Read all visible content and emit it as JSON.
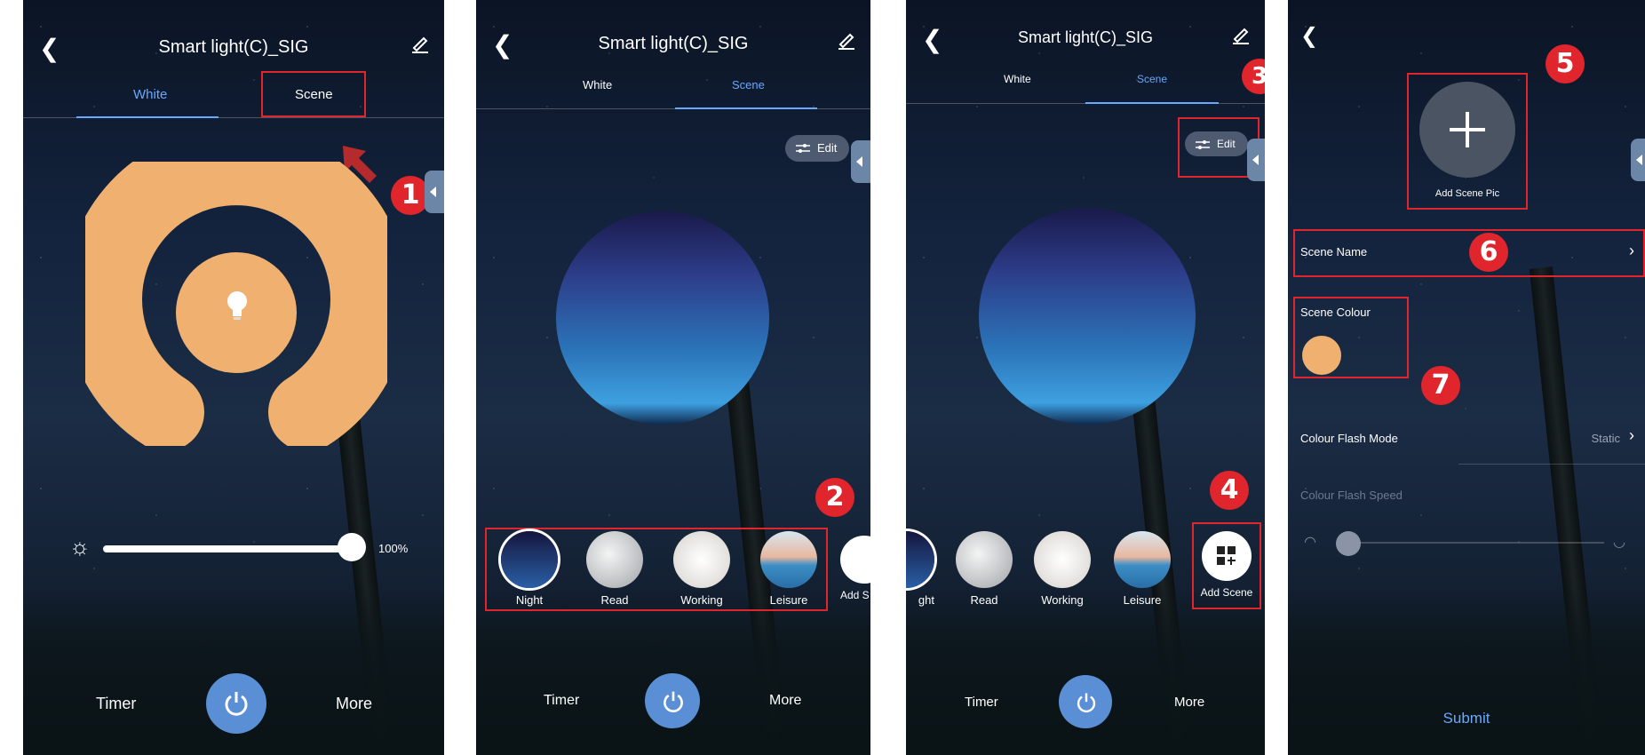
{
  "panel1": {
    "title": "Smart light(C)_SIG",
    "tabs": [
      "White",
      "Scene"
    ],
    "brightness_percent": "100%",
    "brightness_value": 1.0,
    "bottom": {
      "timer": "Timer",
      "more": "More"
    },
    "badge": "1"
  },
  "panel2": {
    "title": "Smart light(C)_SIG",
    "tabs": [
      "White",
      "Scene"
    ],
    "edit_label": "Edit",
    "scenes": [
      "Night",
      "Read",
      "Working",
      "Leisure",
      "Add S"
    ],
    "bottom": {
      "timer": "Timer",
      "more": "More"
    },
    "badge": "2"
  },
  "panel3": {
    "title": "Smart light(C)_SIG",
    "tabs": [
      "White",
      "Scene"
    ],
    "edit_label": "Edit",
    "scenes": [
      "ght",
      "Read",
      "Working",
      "Leisure",
      "Add Scene"
    ],
    "bottom": {
      "timer": "Timer",
      "more": "More"
    },
    "badges": [
      "3",
      "4"
    ]
  },
  "panel4": {
    "add_pic_label": "Add Scene Pic",
    "scene_name_label": "Scene Name",
    "scene_colour_label": "Scene Colour",
    "flash_mode_label": "Colour Flash Mode",
    "flash_mode_value": "Static",
    "flash_speed_label": "Colour Flash Speed",
    "submit_label": "Submit",
    "badges": [
      "5",
      "6",
      "7"
    ]
  },
  "colors": {
    "accent_orange": "#f0b070",
    "accent_blue": "#6aa7ff",
    "highlight_red": "#e0262c",
    "power_blue": "#5a8fd6"
  }
}
